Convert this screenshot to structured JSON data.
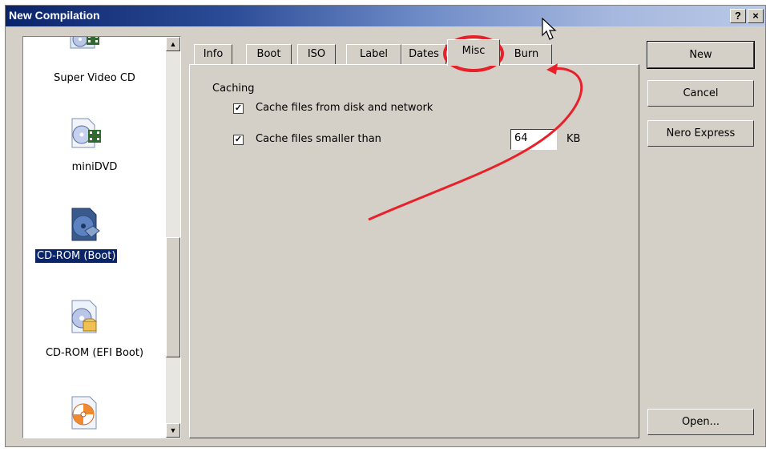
{
  "window": {
    "title": "New Compilation",
    "help_label": "?",
    "close_label": "×"
  },
  "compilation_types": [
    {
      "label": "Super Video CD",
      "icon": "super-video-cd-icon",
      "selected": false
    },
    {
      "label": "miniDVD",
      "icon": "minidvd-icon",
      "selected": false
    },
    {
      "label": "CD-ROM (Boot)",
      "icon": "cd-rom-boot-icon",
      "selected": true
    },
    {
      "label": "CD-ROM (EFI Boot)",
      "icon": "cd-rom-efi-boot-icon",
      "selected": false
    },
    {
      "label": "",
      "icon": "disc-icon",
      "selected": false
    }
  ],
  "tabs": [
    {
      "label": "Info",
      "active": false
    },
    {
      "label": "Boot",
      "active": false
    },
    {
      "label": "ISO",
      "active": false
    },
    {
      "label": "Label",
      "active": false
    },
    {
      "label": "Dates",
      "active": false
    },
    {
      "label": "Misc",
      "active": true
    },
    {
      "label": "Burn",
      "active": false
    }
  ],
  "misc": {
    "group_label": "Caching",
    "cache_disk_network": {
      "label": "Cache files from disk and network",
      "checked": true
    },
    "cache_smaller_than": {
      "label": "Cache files smaller than",
      "checked": true
    },
    "cache_size_value": "64",
    "cache_size_unit": "KB"
  },
  "buttons": {
    "new": "New",
    "cancel": "Cancel",
    "nero_express": "Nero Express",
    "open": "Open..."
  },
  "annotation_color": "#e8202a"
}
